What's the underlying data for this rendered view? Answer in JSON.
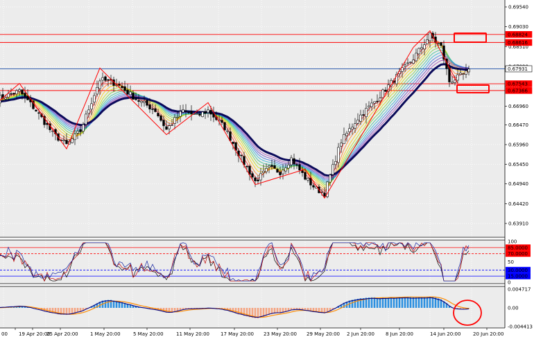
{
  "chart_data": [
    {
      "panel": "price",
      "type": "candlestick",
      "title": "",
      "y_ticks": [
        "0.69540",
        "0.69030",
        "0.68510",
        "0.67990",
        "0.67470",
        "0.66960",
        "0.66470",
        "0.65960",
        "0.65450",
        "0.64940",
        "0.64420",
        "0.63910"
      ],
      "ylim": [
        0.6355,
        0.6972
      ],
      "grid": true,
      "indicators": [
        "candles",
        "rainbow moving-average ribbon",
        "thick navy moving average",
        "red zigzag"
      ],
      "price_labels": [
        {
          "text": "0.68824",
          "value": 0.68824,
          "color": "#ff0000"
        },
        {
          "text": "0.68616",
          "value": 0.68616,
          "color": "#ff0000"
        },
        {
          "text": "0.67931",
          "value": 0.67931,
          "color": "#000000"
        },
        {
          "text": "0.67543",
          "value": 0.67543,
          "color": "#ff0000"
        },
        {
          "text": "0.67366",
          "value": 0.67366,
          "color": "#ff0000"
        }
      ],
      "horizontal_lines": [
        {
          "value": 0.68824,
          "color": "#ff0000"
        },
        {
          "value": 0.68616,
          "color": "#ff0000"
        },
        {
          "value": 0.67931,
          "color": "#1c4fa8"
        },
        {
          "value": 0.67543,
          "color": "#ff0000"
        },
        {
          "value": 0.67366,
          "color": "#ff0000"
        }
      ],
      "zigzag": [
        [
          0,
          0.6705
        ],
        [
          8,
          0.6755
        ],
        [
          25,
          0.6585
        ],
        [
          37,
          0.6795
        ],
        [
          61,
          0.6622
        ],
        [
          76,
          0.6705
        ],
        [
          93,
          0.6492
        ],
        [
          111,
          0.6532
        ],
        [
          118,
          0.6457
        ],
        [
          150,
          0.6849
        ],
        [
          156,
          0.6892
        ],
        [
          166,
          0.6755
        ]
      ],
      "key_closes": [
        [
          0,
          0.6715
        ],
        [
          8,
          0.6735
        ],
        [
          14,
          0.6685
        ],
        [
          20,
          0.6625
        ],
        [
          25,
          0.6595
        ],
        [
          30,
          0.6632
        ],
        [
          37,
          0.6765
        ],
        [
          43,
          0.6755
        ],
        [
          50,
          0.6715
        ],
        [
          57,
          0.6685
        ],
        [
          61,
          0.6635
        ],
        [
          67,
          0.6685
        ],
        [
          72,
          0.667
        ],
        [
          76,
          0.6685
        ],
        [
          82,
          0.664
        ],
        [
          88,
          0.656
        ],
        [
          93,
          0.65
        ],
        [
          98,
          0.6535
        ],
        [
          102,
          0.6525
        ],
        [
          106,
          0.656
        ],
        [
          111,
          0.651
        ],
        [
          115,
          0.648
        ],
        [
          118,
          0.647
        ],
        [
          124,
          0.6605
        ],
        [
          130,
          0.6665
        ],
        [
          137,
          0.6715
        ],
        [
          143,
          0.6765
        ],
        [
          150,
          0.682
        ],
        [
          156,
          0.688
        ],
        [
          160,
          0.685
        ],
        [
          163,
          0.676
        ],
        [
          166,
          0.677
        ],
        [
          170,
          0.6786
        ]
      ],
      "x_ticks": [
        "00",
        "19 Apr 20:00",
        "25 Apr 20:00",
        "1 May 20:00",
        "5 May 20:00",
        "11 May 20:00",
        "17 May 20:00",
        "23 May 20:00",
        "29 May 20:00",
        "2 Jun 20:00",
        "8 Jun 20:00",
        "14 Jun 20:00",
        "20 Jun 20:00"
      ]
    },
    {
      "panel": "oscillator",
      "type": "line",
      "y_ticks": [
        "100",
        "85.0000",
        "70.0000",
        "50",
        "30.0000",
        "15.0000",
        "0"
      ],
      "ylim": [
        0,
        100
      ],
      "levels": [
        {
          "value": 85,
          "label": "85.0000",
          "color": "#ff0000"
        },
        {
          "value": 70,
          "label": "70.0000",
          "color": "#ff0000"
        },
        {
          "value": 30,
          "label": "30.0000",
          "color": "#0000ff"
        },
        {
          "value": 15,
          "label": "15.0000",
          "color": "#0000ff"
        }
      ],
      "series_colors": [
        "#000000",
        "#c00000",
        "#1020a0"
      ]
    },
    {
      "panel": "macd",
      "type": "histogram+line",
      "y_ticks": [
        "0.004717",
        "0.00",
        "-0.004413"
      ],
      "ylim": [
        -0.004413,
        0.004717
      ],
      "colors": {
        "positive": "#2a8fe0",
        "negative": "#f4a582",
        "signal": "#ff8c00",
        "main": "#000080"
      }
    }
  ],
  "annotations": {
    "box_color": "#ff0000",
    "circle_color": "#ff0000"
  }
}
